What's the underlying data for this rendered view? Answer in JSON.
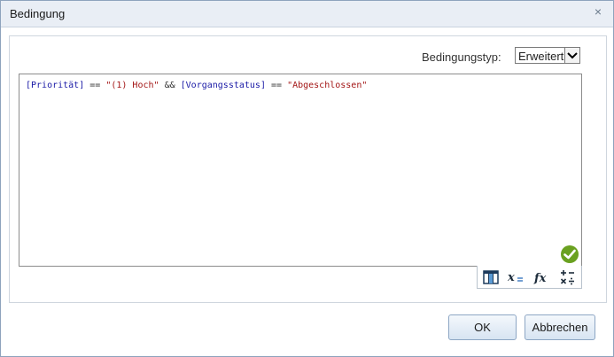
{
  "dialog": {
    "title": "Bedingung",
    "close_glyph": "×"
  },
  "condition": {
    "type_label": "Bedingungstyp:",
    "type_value": "Erweitert",
    "expression": {
      "field1": "[Priorität]",
      "op1": " == ",
      "value1": "\"(1) Hoch\"",
      "and": " && ",
      "field2": "[Vorgangsstatus]",
      "op2": " == ",
      "value2": "\"Abgeschlossen\""
    },
    "status_icon": "valid-check-icon"
  },
  "toolbar": {
    "icons": [
      "columns-icon",
      "variable-icon",
      "function-icon",
      "operators-icon"
    ]
  },
  "buttons": {
    "ok_label": "OK",
    "cancel_label": "Abbrechen"
  },
  "colors": {
    "field": "#1a1aa6",
    "string": "#a31515",
    "valid": "#6aa120"
  }
}
